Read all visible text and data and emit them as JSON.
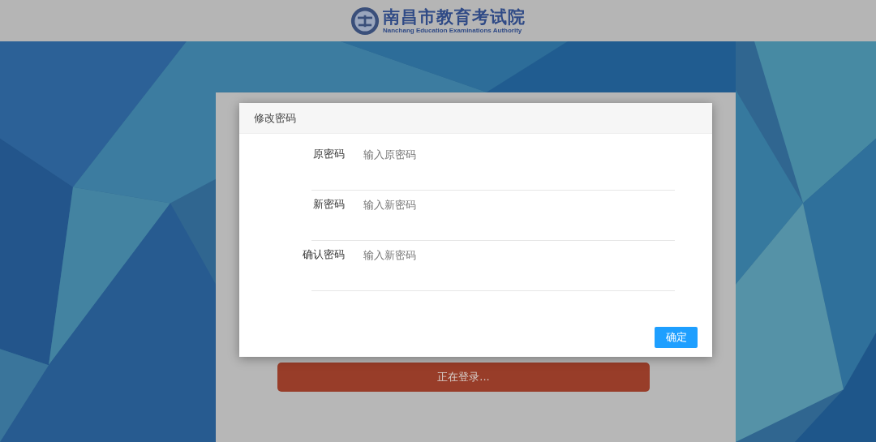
{
  "header": {
    "logo_name": "南昌市教育考试院",
    "logo_subtitle": "Nanchang Education Examinations Authority"
  },
  "login": {
    "button": "正在登录...",
    "loading": true
  },
  "dialog": {
    "title": "修改密码",
    "fields": [
      {
        "label": "原密码",
        "placeholder": "输入原密码"
      },
      {
        "label": "新密码",
        "placeholder": "输入新密码"
      },
      {
        "label": "确认密码",
        "placeholder": "输入新密码"
      }
    ],
    "confirm_button": "确定"
  }
}
